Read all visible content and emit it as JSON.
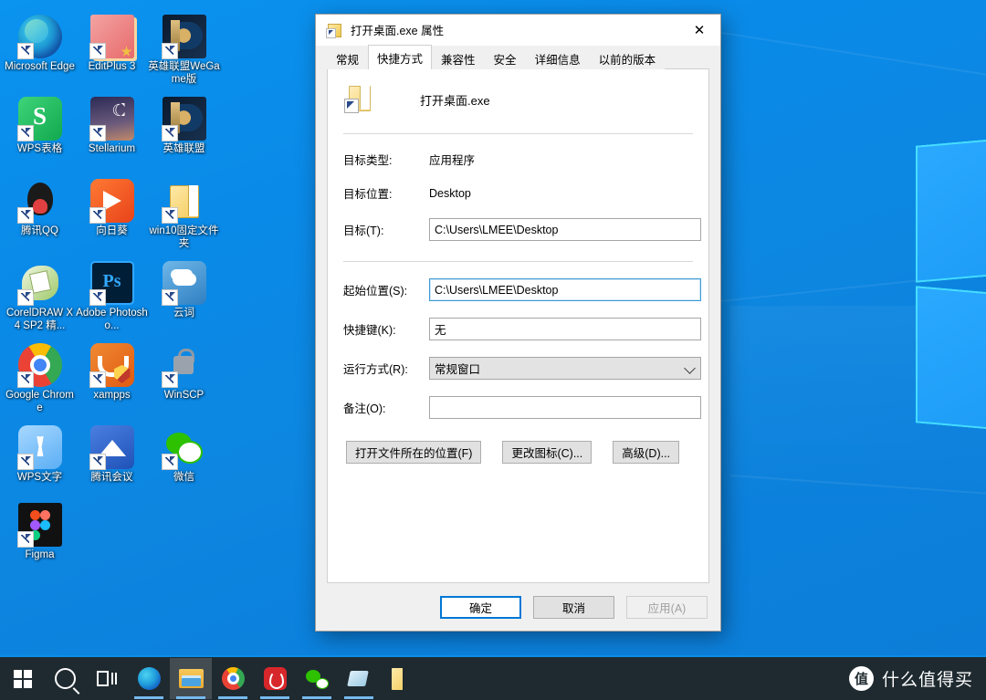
{
  "desktop": {
    "icons": [
      {
        "label": "Microsoft Edge",
        "icon": "edge-icon",
        "art": "ic-edge"
      },
      {
        "label": "EditPlus 3",
        "icon": "editplus-icon",
        "art": "ic-editplus"
      },
      {
        "label": "英雄联盟WeGame版",
        "icon": "league-of-legends-wegame-icon",
        "art": "ic-lol"
      },
      {
        "label": "WPS表格",
        "icon": "wps-spreadsheet-icon",
        "art": "ic-wps-s"
      },
      {
        "label": "Stellarium",
        "icon": "stellarium-icon",
        "art": "ic-stell"
      },
      {
        "label": "英雄联盟",
        "icon": "league-of-legends-icon",
        "art": "ic-lol"
      },
      {
        "label": "腾讯QQ",
        "icon": "tencent-qq-icon",
        "art": "ic-qq"
      },
      {
        "label": "向日葵",
        "icon": "sunflower-remote-icon",
        "art": "ic-sun"
      },
      {
        "label": "win10固定文件夹",
        "icon": "folder-icon",
        "art": "ic-folder"
      },
      {
        "label": "CorelDRAW X4 SP2 精...",
        "icon": "coreldraw-icon",
        "art": "ic-corel"
      },
      {
        "label": "Adobe Photosho...",
        "icon": "adobe-photoshop-icon",
        "art": "ic-ps"
      },
      {
        "label": "云词",
        "icon": "yunci-icon",
        "art": "ic-yunci"
      },
      {
        "label": "Google Chrome",
        "icon": "google-chrome-icon",
        "art": "ic-chrome"
      },
      {
        "label": "xampps",
        "icon": "xampp-icon",
        "art": "ic-xampp"
      },
      {
        "label": "WinSCP",
        "icon": "winscp-icon",
        "art": "ic-winscp"
      },
      {
        "label": "WPS文字",
        "icon": "wps-writer-icon",
        "art": "ic-wpsw"
      },
      {
        "label": "腾讯会议",
        "icon": "tencent-meeting-icon",
        "art": "ic-meeting"
      },
      {
        "label": "微信",
        "icon": "wechat-icon",
        "art": "ic-wechat"
      },
      {
        "label": "Figma",
        "icon": "figma-icon",
        "art": "ic-figma"
      }
    ]
  },
  "dialog": {
    "title": "打开桌面.exe 属性",
    "close_label": "✕",
    "tabs": [
      {
        "label": "常规",
        "active": false
      },
      {
        "label": "快捷方式",
        "active": true
      },
      {
        "label": "兼容性",
        "active": false
      },
      {
        "label": "安全",
        "active": false
      },
      {
        "label": "详细信息",
        "active": false
      },
      {
        "label": "以前的版本",
        "active": false
      }
    ],
    "header_name": "打开桌面.exe",
    "fields": {
      "target_type_label": "目标类型:",
      "target_type_value": "应用程序",
      "target_location_label": "目标位置:",
      "target_location_value": "Desktop",
      "target_label": "目标(T):",
      "target_value": "C:\\Users\\LMEE\\Desktop",
      "start_in_label": "起始位置(S):",
      "start_in_value": "C:\\Users\\LMEE\\Desktop",
      "shortcut_key_label": "快捷键(K):",
      "shortcut_key_value": "无",
      "run_label": "运行方式(R):",
      "run_value": "常规窗口",
      "comment_label": "备注(O):",
      "comment_value": ""
    },
    "action_buttons": [
      {
        "label": "打开文件所在的位置(F)"
      },
      {
        "label": "更改图标(C)..."
      },
      {
        "label": "高级(D)..."
      }
    ],
    "footer_buttons": [
      {
        "label": "确定",
        "state": "default"
      },
      {
        "label": "取消",
        "state": "normal"
      },
      {
        "label": "应用(A)",
        "state": "disabled"
      }
    ]
  },
  "taskbar": {
    "items": [
      {
        "name": "start-button",
        "art": "g-start",
        "state": "normal"
      },
      {
        "name": "search-icon",
        "art": "g-search",
        "state": "normal"
      },
      {
        "name": "task-view-icon",
        "art": "g-taskview",
        "state": "normal"
      },
      {
        "name": "taskbar-edge-icon",
        "art": "g-edge",
        "state": "running"
      },
      {
        "name": "taskbar-file-explorer-icon",
        "art": "g-explorer",
        "state": "active"
      },
      {
        "name": "taskbar-chrome-icon",
        "art": "g-chrome",
        "state": "running"
      },
      {
        "name": "taskbar-netease-music-icon",
        "art": "g-netease",
        "state": "running"
      },
      {
        "name": "taskbar-wechat-icon",
        "art": "g-wechat",
        "state": "running"
      },
      {
        "name": "taskbar-paper-icon",
        "art": "g-paper",
        "state": "running"
      },
      {
        "name": "taskbar-folder-icon",
        "art": "g-folder2",
        "state": "normal"
      }
    ],
    "watermark_badge": "值",
    "watermark_text": "什么值得买"
  }
}
